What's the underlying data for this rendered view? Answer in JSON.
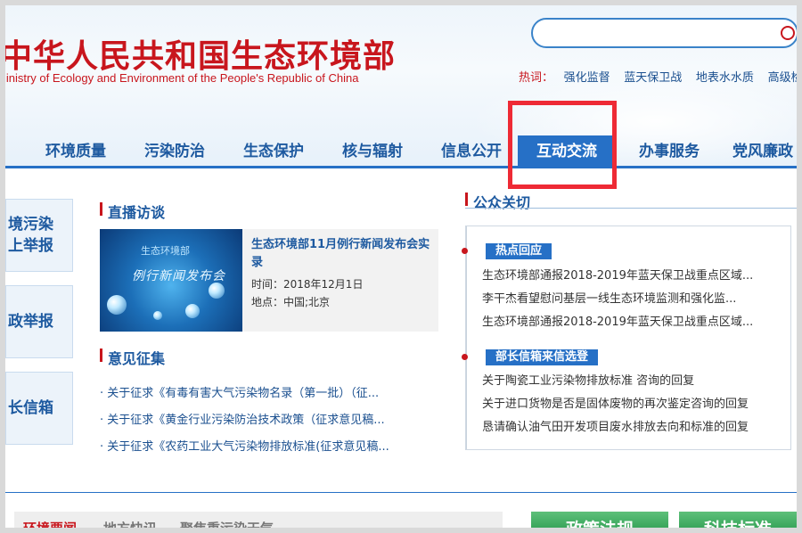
{
  "header": {
    "logo_cn": "中华人民共和国生态环境部",
    "logo_en": "Ministry of Ecology and Environment of the People's Republic of China",
    "hot_label": "热词：",
    "hot_words": [
      "强化监督",
      "蓝天保卫战",
      "地表水水质",
      "高级检"
    ]
  },
  "nav": [
    "环境质量",
    "污染防治",
    "生态保护",
    "核与辐射",
    "信息公开",
    "互动交流",
    "办事服务",
    "党风廉政"
  ],
  "nav_active": "互动交流",
  "left_tabs": [
    {
      "lines": [
        "境污染",
        "上举报"
      ]
    },
    {
      "lines": [
        "政举报"
      ]
    },
    {
      "lines": [
        "长信箱"
      ]
    }
  ],
  "live": {
    "title": "直播访谈",
    "thumb_line1": "生态环境部",
    "thumb_line2": "例行新闻发布会",
    "video_title": "生态环境部11月例行新闻发布会实录",
    "time": "时间：2018年12月1日",
    "place": "地点：中国;北京"
  },
  "opinions": {
    "title": "意见征集",
    "items": [
      "· 关于征求《有毒有害大气污染物名录（第一批）（征...",
      "· 关于征求《黄金行业污染防治技术政策（征求意见稿...",
      "· 关于征求《农药工业大气污染物排放标准(征求意见稿..."
    ]
  },
  "public": {
    "title": "公众关切",
    "hot_badge": "热点回应",
    "hot_items": [
      "生态环境部通报2018-2019年蓝天保卫战重点区域...",
      "李干杰看望慰问基层一线生态环境监测和强化监...",
      "生态环境部通报2018-2019年蓝天保卫战重点区域..."
    ],
    "mail_badge": "部长信箱来信选登",
    "mail_items": [
      "关于陶瓷工业污染物排放标准 咨询的回复",
      "关于进口货物是否是固体废物的再次鉴定咨询的回复",
      "恳请确认油气田开发项目废水排放去向和标准的回复"
    ]
  },
  "bottom": {
    "tabs": [
      "环境要闻",
      "地方快讯",
      "聚焦重污染天气"
    ],
    "buttons": [
      "政策法规",
      "科技标准"
    ]
  },
  "colors": {
    "brand_red": "#c8161d",
    "nav_blue": "#2670c6",
    "highlight_red": "#ee2a35"
  }
}
